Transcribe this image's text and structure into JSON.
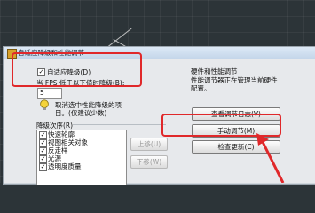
{
  "dialog": {
    "title": "自适应降级和性能调节",
    "adaptive_checkbox_label": "自适应降级(D)",
    "fps_label": "当 FPS 低于以下值时降级(B):",
    "fps_value": "5",
    "tip_text": "取消选中性能降级的项目。(仅建议少数)",
    "degrade_order_label": "降级次序(R)",
    "degrade_items": [
      {
        "label": "快速轮廓",
        "checked": true
      },
      {
        "label": "视图相关对象",
        "checked": true
      },
      {
        "label": "反走样",
        "checked": true
      },
      {
        "label": "光源",
        "checked": true
      },
      {
        "label": "透明度质量",
        "checked": true
      }
    ],
    "move_up_label": "上移(U)",
    "move_down_label": "下移(W)",
    "right_group_title": "硬件和性能调节",
    "right_group_desc": "性能调节器正在管理当前硬件配置。",
    "view_log_button": "查看调节日志(V)",
    "manual_tune_button": "手动调节(M)",
    "check_update_button": "检查更新(C)"
  },
  "colors": {
    "highlight_red": "#e0282a",
    "workspace_bg": "#2c3438"
  }
}
